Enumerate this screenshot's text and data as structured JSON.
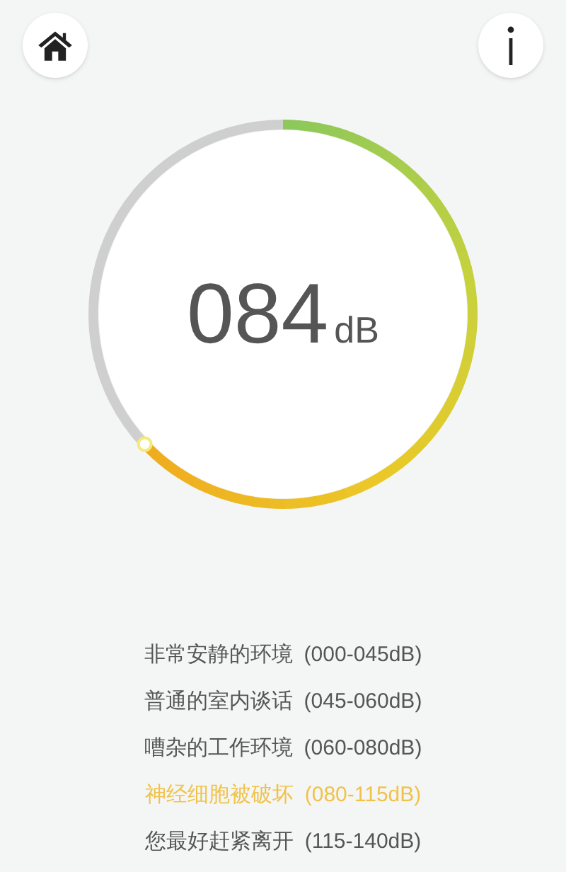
{
  "reading": {
    "value": "084",
    "unit": "dB"
  },
  "legend": [
    {
      "label": "非常安静的环境",
      "range": "(000-045dB)",
      "selected": false
    },
    {
      "label": "普通的室内谈话",
      "range": "(045-060dB)",
      "selected": false
    },
    {
      "label": "嘈杂的工作环境",
      "range": "(060-080dB)",
      "selected": false
    },
    {
      "label": "神经细胞被破坏",
      "range": "(080-115dB)",
      "selected": true
    },
    {
      "label": "您最好赶紧离开",
      "range": "(115-140dB)",
      "selected": false
    }
  ]
}
